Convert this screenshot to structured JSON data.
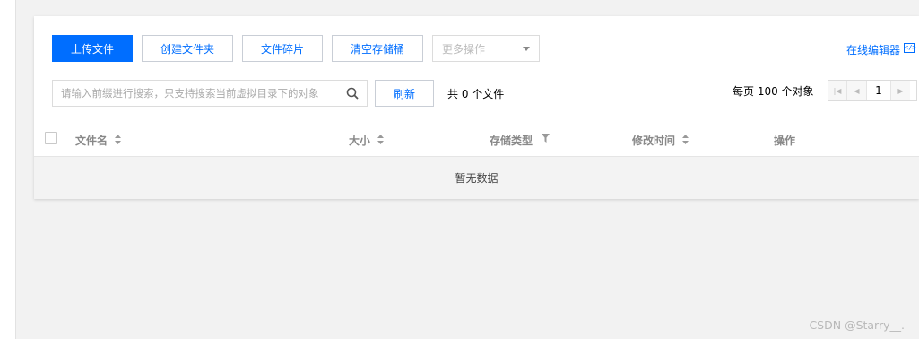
{
  "toolbar": {
    "upload_label": "上传文件",
    "create_folder_label": "创建文件夹",
    "file_fragments_label": "文件碎片",
    "clear_bucket_label": "清空存储桶",
    "more_actions_label": "更多操作",
    "online_editor_label": "在线编辑器"
  },
  "search": {
    "placeholder": "请输入前缀进行搜索，只支持搜索当前虚拟目录下的对象",
    "refresh_label": "刷新",
    "total_text": "共 0 个文件"
  },
  "pagination": {
    "per_page_text": "每页 100 个对象",
    "current_page": "1"
  },
  "table": {
    "columns": [
      "文件名",
      "大小",
      "存储类型",
      "修改时间",
      "操作"
    ],
    "empty_text": "暂无数据"
  },
  "watermark": "CSDN @Starry__.",
  "colors": {
    "accent": "#006eff",
    "header_text": "#888888",
    "empty_row_bg": "#f3f3f3"
  }
}
